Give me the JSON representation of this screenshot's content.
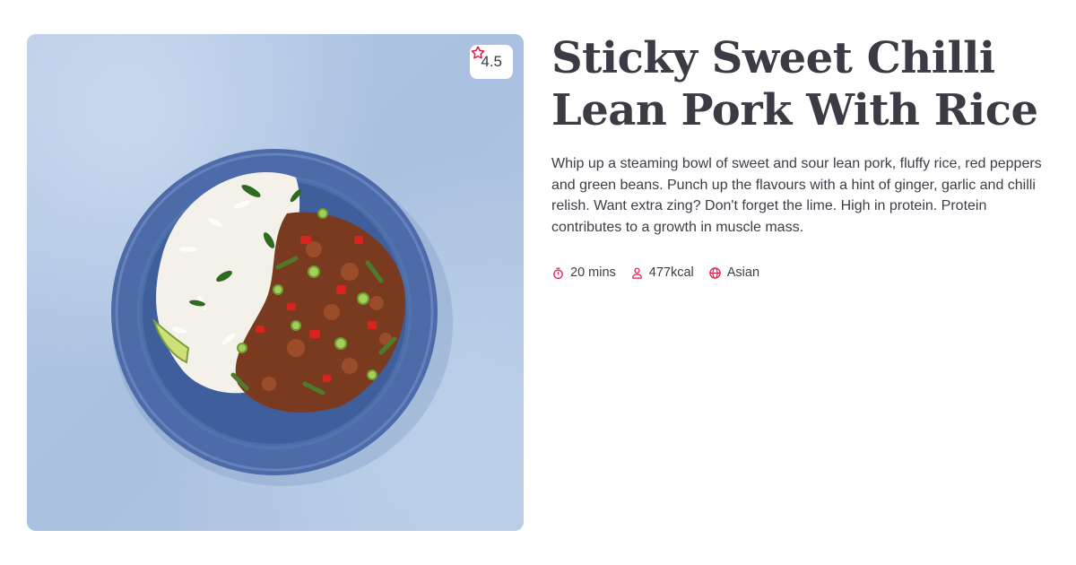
{
  "recipe": {
    "title": "Sticky Sweet Chilli Lean Pork With Rice",
    "description": "Whip up a steaming bowl of sweet and sour lean pork, fluffy rice, red peppers and green beans. Punch up the flavours with a hint of ginger, garlic and chilli relish. Want extra zing? Don't forget the lime. High in protein. Protein contributes to a growth in muscle mass.",
    "rating": "4.5",
    "rating_icon": "star-outline-icon",
    "meta": {
      "time": "20 mins",
      "time_icon": "stopwatch-icon",
      "calories": "477kcal",
      "calories_icon": "person-icon",
      "cuisine": "Asian",
      "cuisine_icon": "globe-icon"
    },
    "image_subject": "plate-of-pork-and-rice"
  },
  "colors": {
    "accent": "#e8174b",
    "text": "#3b3b45",
    "plate": "#4a6aa8",
    "background_blue": "#afc4e2"
  }
}
